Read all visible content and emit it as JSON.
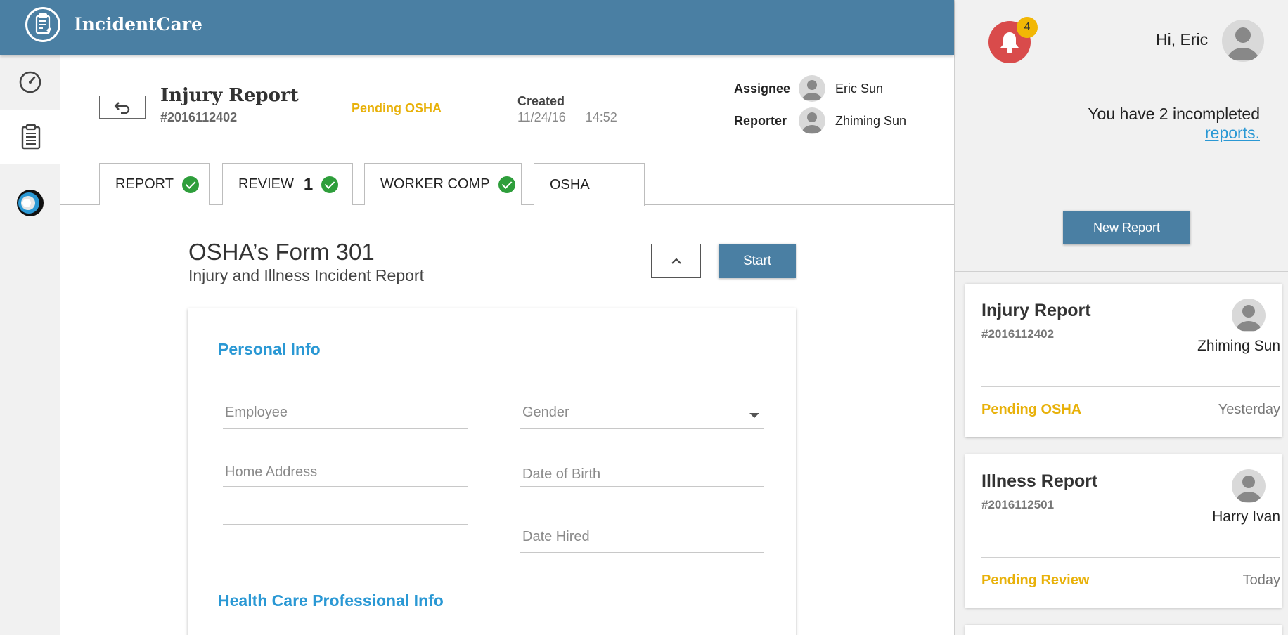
{
  "app": {
    "title": "IncidentCare",
    "colors": {
      "brand": "#4a7fa3",
      "accent": "#2a98d4",
      "pending": "#e8b10a",
      "success": "#2e9e3b",
      "alert": "#d94b4b"
    }
  },
  "nav": {
    "items": [
      {
        "icon": "dashboard-gauge-icon"
      },
      {
        "icon": "clipboard-icon",
        "active": true
      },
      {
        "icon": "circle-logo-icon"
      }
    ]
  },
  "report": {
    "title": "Injury Report",
    "number": "#2016112402",
    "status": "Pending OSHA",
    "created_label": "Created",
    "created_date": "11/24/16",
    "created_time": "14:52",
    "assignee_label": "Assignee",
    "assignee_name": "Eric Sun",
    "reporter_label": "Reporter",
    "reporter_name": "Zhiming Sun"
  },
  "tabs": [
    {
      "label": "REPORT",
      "complete": true
    },
    {
      "label": "REVIEW",
      "count": "1",
      "complete": true
    },
    {
      "label": "WORKER COMP",
      "complete": true
    },
    {
      "label": "OSHA",
      "selected": true
    }
  ],
  "form": {
    "title": "OSHA’s Form 301",
    "subtitle": "Injury and Illness Incident Report",
    "start_label": "Start",
    "sections": {
      "personal": "Personal Info",
      "health": "Health Care Professional Info"
    },
    "fields": {
      "employee": "Employee",
      "gender": "Gender",
      "home_address": "Home Address",
      "address_line2": "",
      "date_of_birth": "Date of Birth",
      "date_hired": "Date Hired"
    }
  },
  "sidepanel": {
    "notification_count": "4",
    "greeting": "Hi, Eric",
    "incomplete_text": "You have 2 incompleted",
    "incomplete_link": "reports.",
    "new_report_label": "New Report",
    "cards": [
      {
        "title": "Injury Report",
        "number": "#2016112402",
        "person": "Zhiming Sun",
        "status": "Pending OSHA",
        "time": "Yesterday"
      },
      {
        "title": "Illness Report",
        "number": "#2016112501",
        "person": "Harry Ivan",
        "status": "Pending Review",
        "time": "Today"
      }
    ]
  }
}
